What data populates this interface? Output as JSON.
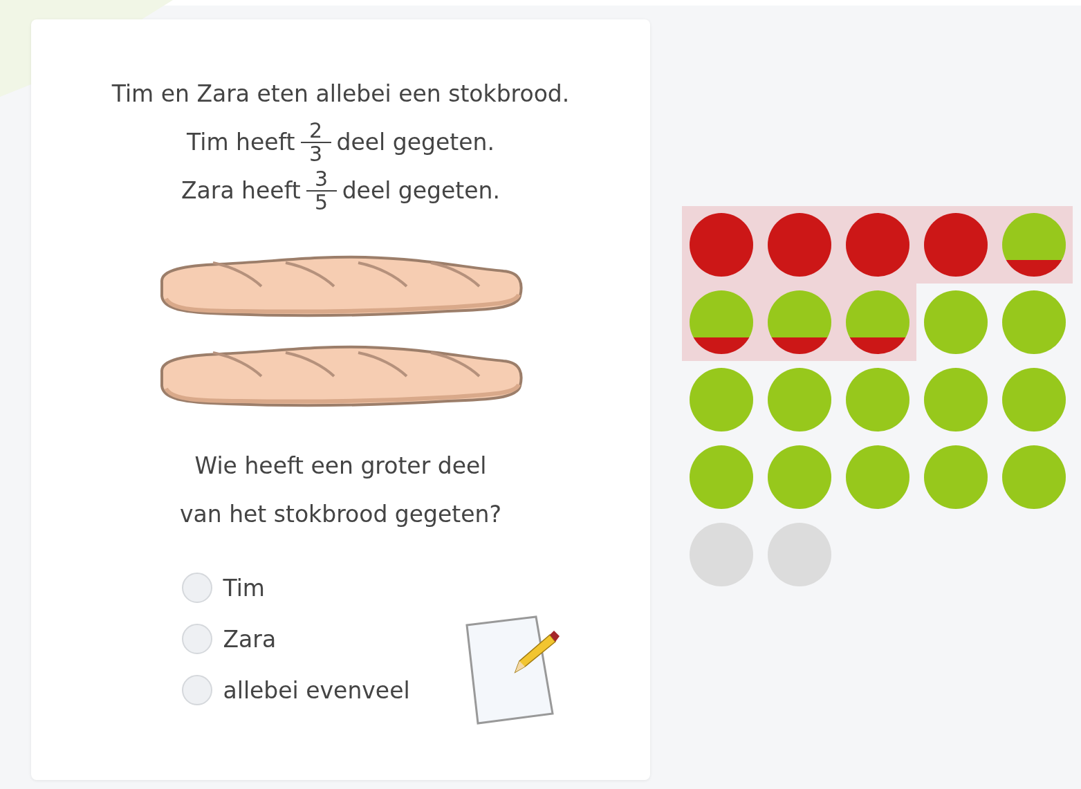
{
  "question": {
    "intro": "Tim en Zara eten allebei een stokbrood.",
    "statements": [
      {
        "before": "Tim heeft",
        "numerator": "2",
        "denominator": "3",
        "after": "deel gegeten."
      },
      {
        "before": "Zara heeft",
        "numerator": "3",
        "denominator": "5",
        "after": "deel gegeten."
      }
    ],
    "prompt": [
      "Wie heeft een groter deel",
      "van het stokbrood gegeten?"
    ],
    "options": [
      {
        "label": "Tim",
        "selected": false
      },
      {
        "label": "Zara",
        "selected": false
      },
      {
        "label": "allebei evenveel",
        "selected": false
      }
    ]
  },
  "progress": [
    {
      "kind": "wrong",
      "highlighted": true
    },
    {
      "kind": "wrong",
      "highlighted": true
    },
    {
      "kind": "wrong",
      "highlighted": true
    },
    {
      "kind": "wrong",
      "highlighted": true
    },
    {
      "kind": "partial",
      "highlighted": true
    },
    {
      "kind": "partial",
      "highlighted": true
    },
    {
      "kind": "partial",
      "highlighted": true
    },
    {
      "kind": "partial",
      "highlighted": true
    },
    {
      "kind": "correct",
      "highlighted": false
    },
    {
      "kind": "correct",
      "highlighted": false
    },
    {
      "kind": "correct",
      "highlighted": false
    },
    {
      "kind": "correct",
      "highlighted": false
    },
    {
      "kind": "correct",
      "highlighted": false
    },
    {
      "kind": "correct",
      "highlighted": false
    },
    {
      "kind": "correct",
      "highlighted": false
    },
    {
      "kind": "correct",
      "highlighted": false
    },
    {
      "kind": "correct",
      "highlighted": false
    },
    {
      "kind": "correct",
      "highlighted": false
    },
    {
      "kind": "correct",
      "highlighted": false
    },
    {
      "kind": "correct",
      "highlighted": false
    },
    {
      "kind": "pending",
      "highlighted": false
    },
    {
      "kind": "pending",
      "highlighted": false
    }
  ]
}
